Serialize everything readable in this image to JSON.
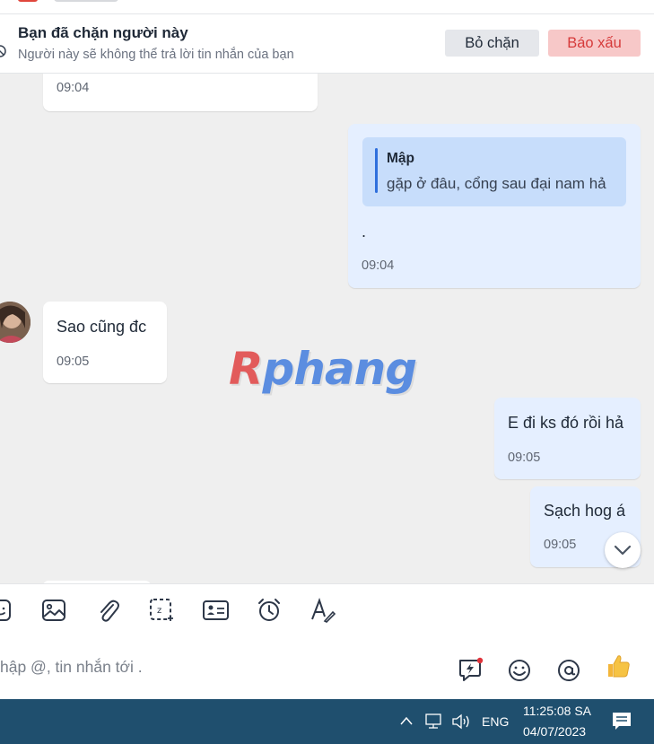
{
  "block_banner": {
    "title": "Bạn đã chặn người này",
    "subtitle": "Người này sẽ không thể trả lời tin nhắn của bạn",
    "unblock_label": "Bỏ chặn",
    "report_label": "Báo xấu"
  },
  "messages": [
    {
      "direction": "in",
      "time": "09:04"
    },
    {
      "direction": "out",
      "quote_name": "Mập",
      "quote_text": "gặp ở đâu, cổng sau đại nam hả",
      "text": ".",
      "time": "09:04"
    },
    {
      "direction": "in",
      "text": "Sao cũng đc",
      "time": "09:05"
    },
    {
      "direction": "out",
      "text": "E đi ks đó rồi hả",
      "time": "09:05"
    },
    {
      "direction": "out",
      "text": "Sạch hog á",
      "time": "09:05"
    }
  ],
  "watermark": {
    "first": "R",
    "rest": "phang"
  },
  "toolbar_icons": [
    "sticker-icon",
    "image-icon",
    "attachment-icon",
    "screenshot-icon",
    "contact-card-icon",
    "reminder-clock-icon",
    "text-format-icon"
  ],
  "composer": {
    "placeholder": "hập @, tin nhắn tới ."
  },
  "taskbar": {
    "language": "ENG",
    "time": "11:25:08 SA",
    "date": "04/07/2023"
  },
  "colors": {
    "accent": "#2f6fdc",
    "report": "#d63a3a",
    "taskbar": "#1f4f6e",
    "outgoing_bubble": "#e5efff",
    "quote_bg": "#c7ddfb"
  }
}
